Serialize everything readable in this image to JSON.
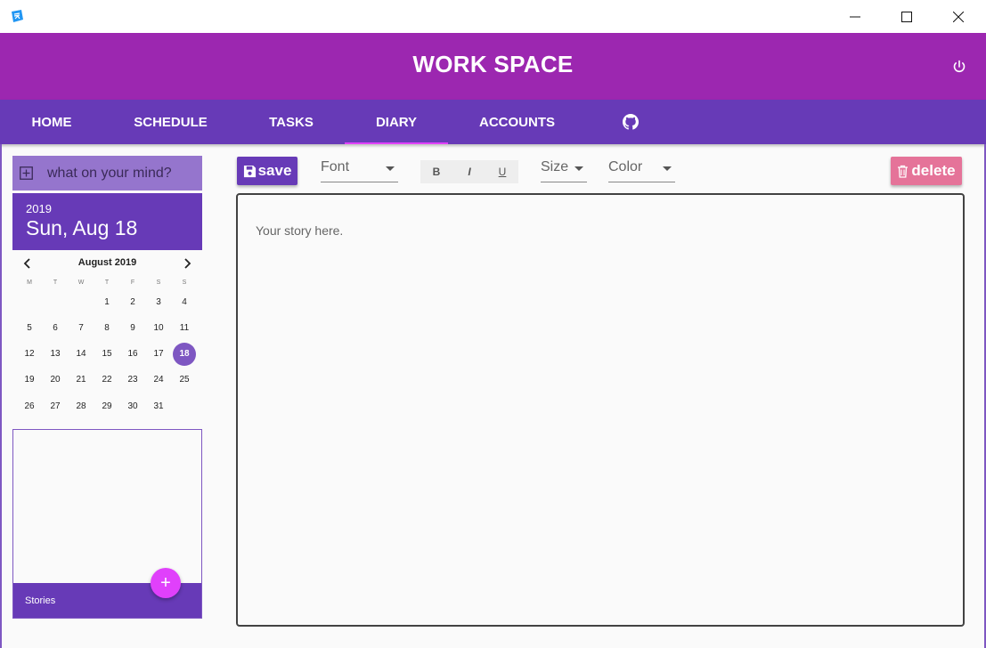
{
  "header": {
    "title": "WORK SPACE"
  },
  "nav": {
    "tabs": [
      {
        "label": "HOME"
      },
      {
        "label": "SCHEDULE"
      },
      {
        "label": "TASKS"
      },
      {
        "label": "DIARY",
        "active": true
      },
      {
        "label": "ACCOUNTS"
      }
    ],
    "extra_icon": "github-icon"
  },
  "sidebar": {
    "mind_placeholder": "what on your mind?",
    "year": "2019",
    "date": "Sun, Aug 18",
    "calendar": {
      "month": "August 2019",
      "weekdays": [
        "M",
        "T",
        "W",
        "T",
        "F",
        "S",
        "S"
      ],
      "weeks": [
        [
          "",
          "",
          "",
          "1",
          "2",
          "3",
          "4"
        ],
        [
          "5",
          "6",
          "7",
          "8",
          "9",
          "10",
          "11"
        ],
        [
          "12",
          "13",
          "14",
          "15",
          "16",
          "17",
          "18"
        ],
        [
          "19",
          "20",
          "21",
          "22",
          "23",
          "24",
          "25"
        ],
        [
          "26",
          "27",
          "28",
          "29",
          "30",
          "31",
          ""
        ]
      ],
      "selected_day": "18"
    },
    "stories_label": "Stories"
  },
  "toolbar": {
    "save_label": "save",
    "font_label": "Font",
    "bold": "B",
    "italic": "I",
    "underline": "U",
    "size_label": "Size",
    "color_label": "Color",
    "delete_label": "delete"
  },
  "editor": {
    "placeholder": "Your story here."
  },
  "colors": {
    "header": "#9c27b0",
    "nav": "#673ab7",
    "accent": "#e040fb",
    "delete": "#e57399"
  }
}
